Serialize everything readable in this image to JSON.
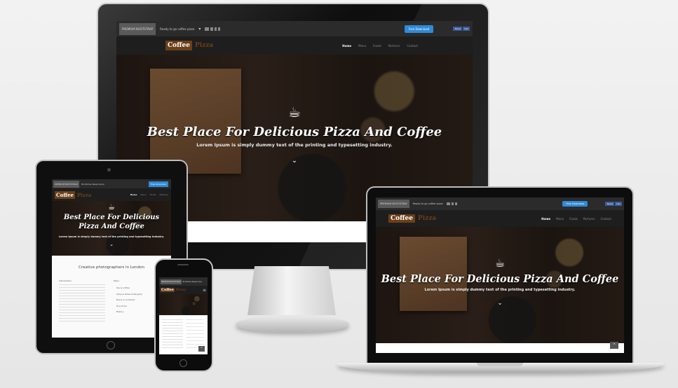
{
  "site": {
    "topbar_logo": "PREMIUM BOOTSTRAP",
    "topbar_text": "Ready to go coffee pizza",
    "download_label": "Free Download",
    "tweet_label": "Tweet",
    "like_label": "Like",
    "brand_coffee": "Coffee",
    "brand_pizza": "Pizza",
    "nav": [
      "Home",
      "Menu",
      "Foods",
      "Partners",
      "Contact"
    ],
    "hero_title": "Best Place For Delicious Pizza And Coffee",
    "hero_subtitle": "Lorem Ipsum is simply dummy text of the printing and typesetting industry.",
    "cup_icon": "coffee-cup-icon",
    "scroll_icon": "chevron-down-icon"
  },
  "tablet": {
    "tb_text": "Bootstrap Responsive",
    "download_label": "Free Download",
    "hero_title": "Best Place For Delicious Pizza And Coffee",
    "about_heading": "Creative photographers in London",
    "intro_label": "Introduction",
    "menu_label": "Menu",
    "menu_items": [
      "Tea & Coffee",
      "Pizza & Pizzeria Naughty",
      "Beers & Cocktails",
      "Fine Drink",
      "Bakery"
    ]
  },
  "colors": {
    "accent": "#2e8bd8",
    "brand": "#6b3f17",
    "background": "#ececec"
  }
}
